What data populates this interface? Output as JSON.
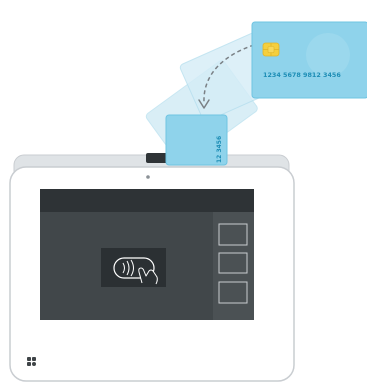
{
  "illustration": {
    "subject": "payment-terminal-card-insert",
    "colors": {
      "card_fill": "#8fd3eb",
      "card_fill_light": "#cde9f4",
      "card_text": "#1d8db5",
      "chip": "#f5cf3e",
      "terminal_body": "#ffffff",
      "terminal_outline": "#c9cdd1",
      "screen": "#3f4447",
      "screen_top": "#2e3336",
      "screen_side_panel": "#4b5154"
    },
    "front_card": {
      "number": "1234 5678 9812 3456"
    },
    "inserted_card": {
      "number_fragment": "12 3456"
    },
    "screen": {
      "side_buttons": 3,
      "icon": "contactless-tap-icon"
    },
    "brand_icon": "clover-logo-icon"
  }
}
